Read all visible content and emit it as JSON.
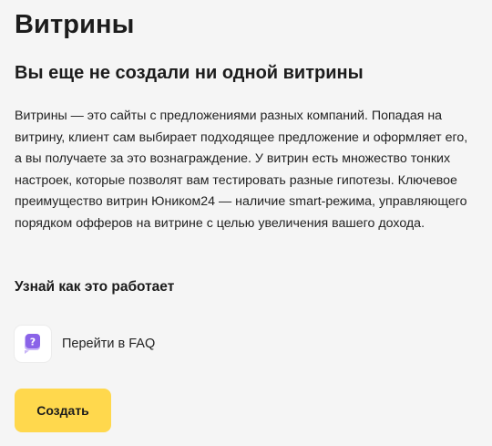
{
  "page": {
    "title": "Витрины"
  },
  "empty_state": {
    "heading": "Вы еще не создали ни одной витрины",
    "description": "Витрины — это сайты с предложениями разных компаний. Попадая на витрину, клиент сам выбирает подходящее предложение и оформляет его, а вы получаете за это вознаграждение. У витрин есть множество тонких настроек, которые позволят вам тестировать разные гипотезы. Ключевое преимущество витрин Юником24 — наличие smart-режима, управляющего порядком офферов на витрине с целью увеличения вашего дохода."
  },
  "how_it_works": {
    "heading": "Узнай как это работает",
    "faq_link": {
      "label": "Перейти в FAQ",
      "icon": "question-chat-icon",
      "icon_glyph": "?"
    }
  },
  "actions": {
    "create_label": "Создать"
  },
  "colors": {
    "background": "#f5f5f5",
    "accent_yellow": "#ffd84d",
    "icon_purple": "#8a63e8",
    "icon_purple_light": "#c9b6f7"
  }
}
